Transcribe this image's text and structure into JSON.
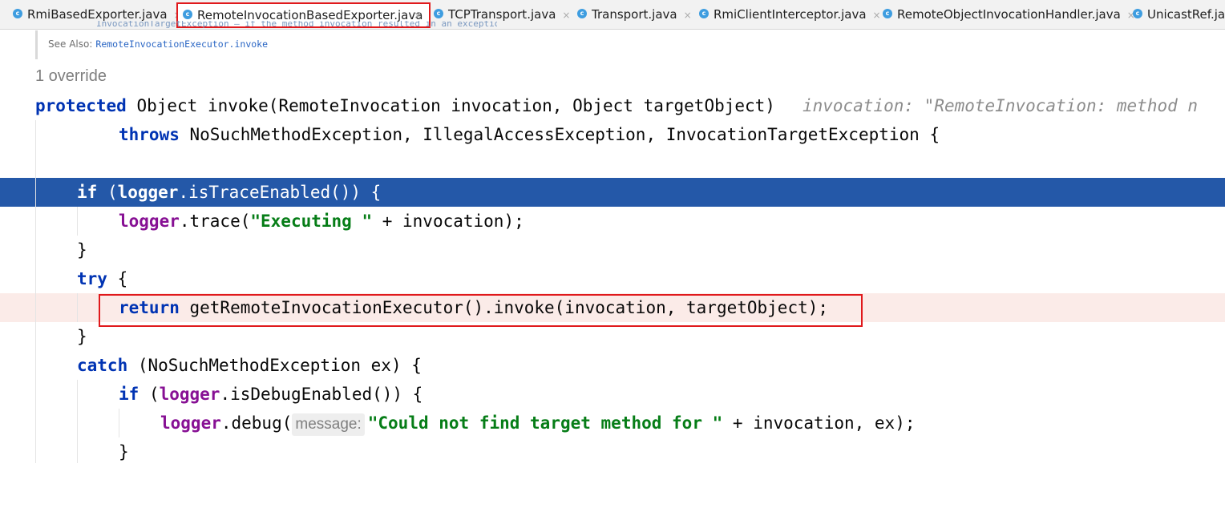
{
  "tabs": [
    {
      "label": "RmiBasedExporter.java",
      "icon": "class-icon"
    },
    {
      "label": "RemoteInvocationBasedExporter.java",
      "icon": "class-icon",
      "active": true
    },
    {
      "label": "TCPTransport.java",
      "icon": "class-icon"
    },
    {
      "label": "Transport.java",
      "icon": "class-icon"
    },
    {
      "label": "RmiClientInterceptor.java",
      "icon": "class-icon"
    },
    {
      "label": "RemoteObjectInvocationHandler.java",
      "icon": "class-icon"
    },
    {
      "label": "UnicastRef.java",
      "icon": "class-icon"
    }
  ],
  "tab_close_glyph": "×",
  "doc": {
    "fragment": "InvocationTargetException – if the method invocation resulted in an exception",
    "see_also_label": "See Also:",
    "see_also_link": "RemoteInvocationExecutor.invoke"
  },
  "override_hint": "1 override",
  "code": {
    "l1_kw": "protected",
    "l1_rest": " Object invoke(RemoteInvocation invocation, Object targetObject)",
    "l1_hint": "invocation: \"RemoteInvocation: method n",
    "l2_kw": "throws",
    "l2_rest": " NoSuchMethodException, IllegalAccessException, InvocationTargetException {",
    "l4_kw": "if",
    "l4_open": " (",
    "l4_field": "logger",
    "l4_rest": ".isTraceEnabled()) {",
    "l5_field": "logger",
    "l5_call": ".trace(",
    "l5_str": "\"Executing \"",
    "l5_rest": " + invocation);",
    "l6": "}",
    "l7_kw": "try",
    "l7_rest": " {",
    "l8_kw": "return",
    "l8_rest": " getRemoteInvocationExecutor().invoke(invocation, targetObject);",
    "l9": "}",
    "l10_kw": "catch",
    "l10_rest": " (NoSuchMethodException ex) {",
    "l11_kw": "if",
    "l11_open": " (",
    "l11_field": "logger",
    "l11_rest": ".isDebugEnabled()) {",
    "l12_field": "logger",
    "l12_call": ".debug(",
    "l12_hint": "message:",
    "l12_str": "\"Could not find target method for \"",
    "l12_rest": " + invocation, ex);",
    "l13": "}"
  },
  "colors": {
    "keyword": "#0033b3",
    "field": "#871094",
    "string": "#067d17",
    "selection": "#2458a8",
    "breakpoint_line": "#fbebe8",
    "annotation_box": "#e0191c"
  }
}
